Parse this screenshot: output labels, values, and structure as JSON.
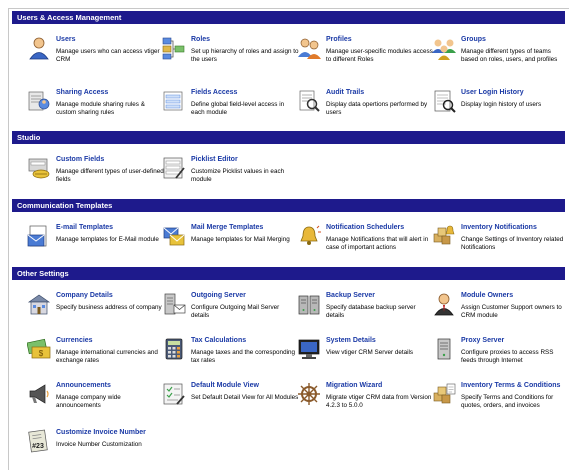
{
  "sections": [
    {
      "title": "Users & Access Management"
    },
    {
      "title": "Studio"
    },
    {
      "title": "Communication Templates"
    },
    {
      "title": "Other Settings"
    }
  ],
  "items": {
    "users": {
      "title": "Users",
      "desc": "Manage users who can access vtiger CRM",
      "icon": "user-icon"
    },
    "roles": {
      "title": "Roles",
      "desc": "Set up hierarchy of roles and assign to the users",
      "icon": "roles-hierarchy-icon"
    },
    "profiles": {
      "title": "Profiles",
      "desc": "Manage user-specific modules access to different Roles",
      "icon": "profiles-icon"
    },
    "groups": {
      "title": "Groups",
      "desc": "Manage different types of teams based on roles, users, and profiles",
      "icon": "groups-icon"
    },
    "sharing_access": {
      "title": "Sharing Access",
      "desc": "Manage module sharing rules & custom sharing rules",
      "icon": "sharing-access-icon"
    },
    "fields_access": {
      "title": "Fields Access",
      "desc": "Define global field-level access in each module",
      "icon": "fields-access-icon"
    },
    "audit_trails": {
      "title": "Audit Trails",
      "desc": "Display data opertions performed by users",
      "icon": "audit-trails-icon"
    },
    "user_login_history": {
      "title": "User Login History",
      "desc": "Display login history of users",
      "icon": "login-history-icon"
    },
    "custom_fields": {
      "title": "Custom Fields",
      "desc": "Manage different types of user-defined fields",
      "icon": "custom-fields-icon"
    },
    "picklist_editor": {
      "title": "Picklist Editor",
      "desc": "Customize Picklist values in each module",
      "icon": "picklist-editor-icon"
    },
    "email_templates": {
      "title": "E-mail Templates",
      "desc": "Manage templates for E-Mail module",
      "icon": "email-template-icon"
    },
    "mail_merge": {
      "title": "Mail Merge Templates",
      "desc": "Manage templates for Mail Merging",
      "icon": "mail-merge-icon"
    },
    "notification_schedulers": {
      "title": "Notification Schedulers",
      "desc": "Manage Notifications that will alert in case of important actions",
      "icon": "notification-bell-icon"
    },
    "inventory_notifications": {
      "title": "Inventory Notifications",
      "desc": "Change Settings of Inventory related Notifications",
      "icon": "inventory-notification-icon"
    },
    "company_details": {
      "title": "Company Details",
      "desc": "Specify business address of company",
      "icon": "company-building-icon"
    },
    "outgoing_server": {
      "title": "Outgoing Server",
      "desc": "Configure Outgoing Mail Server details",
      "icon": "outgoing-server-icon"
    },
    "backup_server": {
      "title": "Backup Server",
      "desc": "Specify database backup server details",
      "icon": "backup-server-icon"
    },
    "module_owners": {
      "title": "Module Owners",
      "desc": "Assign Customer Support owners to CRM module",
      "icon": "module-owners-icon"
    },
    "currencies": {
      "title": "Currencies",
      "desc": "Manage international currencies and exchange rates",
      "icon": "currencies-icon"
    },
    "tax_calculations": {
      "title": "Tax Calculations",
      "desc": "Manage taxes and the corresponding tax rates",
      "icon": "calculator-icon"
    },
    "system_details": {
      "title": "System Details",
      "desc": "View vtiger CRM Server details",
      "icon": "system-monitor-icon"
    },
    "proxy_server": {
      "title": "Proxy Server",
      "desc": "Configure proxies to access RSS feeds through Internet",
      "icon": "proxy-server-icon"
    },
    "announcements": {
      "title": "Announcements",
      "desc": "Manage company wide announcements",
      "icon": "announcement-megaphone-icon"
    },
    "default_module_view": {
      "title": "Default Module View",
      "desc": "Set Default Detail View for All Modules",
      "icon": "default-view-icon"
    },
    "migration_wizard": {
      "title": "Migration Wizard",
      "desc": "Migrate vtiger CRM data from Version 4.2.3 to 5.0.0",
      "icon": "migration-wheel-icon"
    },
    "inventory_terms": {
      "title": "Inventory Terms & Conditions",
      "desc": "Specify Terms and Conditions for quotes, orders, and invoices",
      "icon": "terms-conditions-icon"
    },
    "invoice_number": {
      "title": "Customize Invoice Number",
      "desc": "Invoice Number Customization",
      "icon": "invoice-number-icon"
    }
  }
}
